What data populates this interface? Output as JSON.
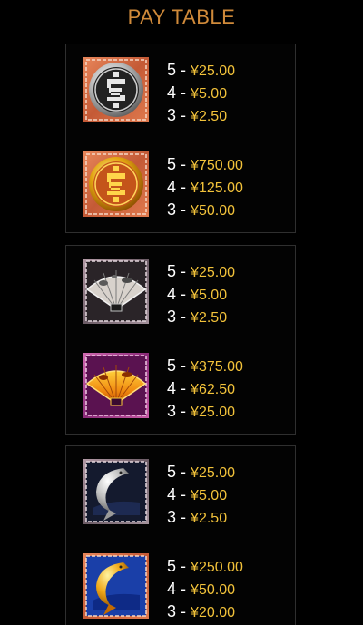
{
  "title": "PAY TABLE",
  "colors": {
    "title": "#d08a3a",
    "amount": "#f2c23a",
    "count": "#ffffff",
    "panel_border": "#2f2f2f"
  },
  "groups": [
    {
      "symbols": [
        {
          "icon": "silver-medallion-icon",
          "pays": [
            {
              "count": "5",
              "amount": "¥25.00"
            },
            {
              "count": "4",
              "amount": "¥5.00"
            },
            {
              "count": "3",
              "amount": "¥2.50"
            }
          ]
        },
        {
          "icon": "gold-medallion-icon",
          "pays": [
            {
              "count": "5",
              "amount": "¥750.00"
            },
            {
              "count": "4",
              "amount": "¥125.00"
            },
            {
              "count": "3",
              "amount": "¥50.00"
            }
          ]
        }
      ]
    },
    {
      "symbols": [
        {
          "icon": "silver-fan-icon",
          "pays": [
            {
              "count": "5",
              "amount": "¥25.00"
            },
            {
              "count": "4",
              "amount": "¥5.00"
            },
            {
              "count": "3",
              "amount": "¥2.50"
            }
          ]
        },
        {
          "icon": "gold-fan-icon",
          "pays": [
            {
              "count": "5",
              "amount": "¥375.00"
            },
            {
              "count": "4",
              "amount": "¥62.50"
            },
            {
              "count": "3",
              "amount": "¥25.00"
            }
          ]
        }
      ]
    },
    {
      "symbols": [
        {
          "icon": "silver-koi-icon",
          "pays": [
            {
              "count": "5",
              "amount": "¥25.00"
            },
            {
              "count": "4",
              "amount": "¥5.00"
            },
            {
              "count": "3",
              "amount": "¥2.50"
            }
          ]
        },
        {
          "icon": "gold-koi-icon",
          "pays": [
            {
              "count": "5",
              "amount": "¥250.00"
            },
            {
              "count": "4",
              "amount": "¥50.00"
            },
            {
              "count": "3",
              "amount": "¥20.00"
            }
          ]
        }
      ]
    }
  ]
}
